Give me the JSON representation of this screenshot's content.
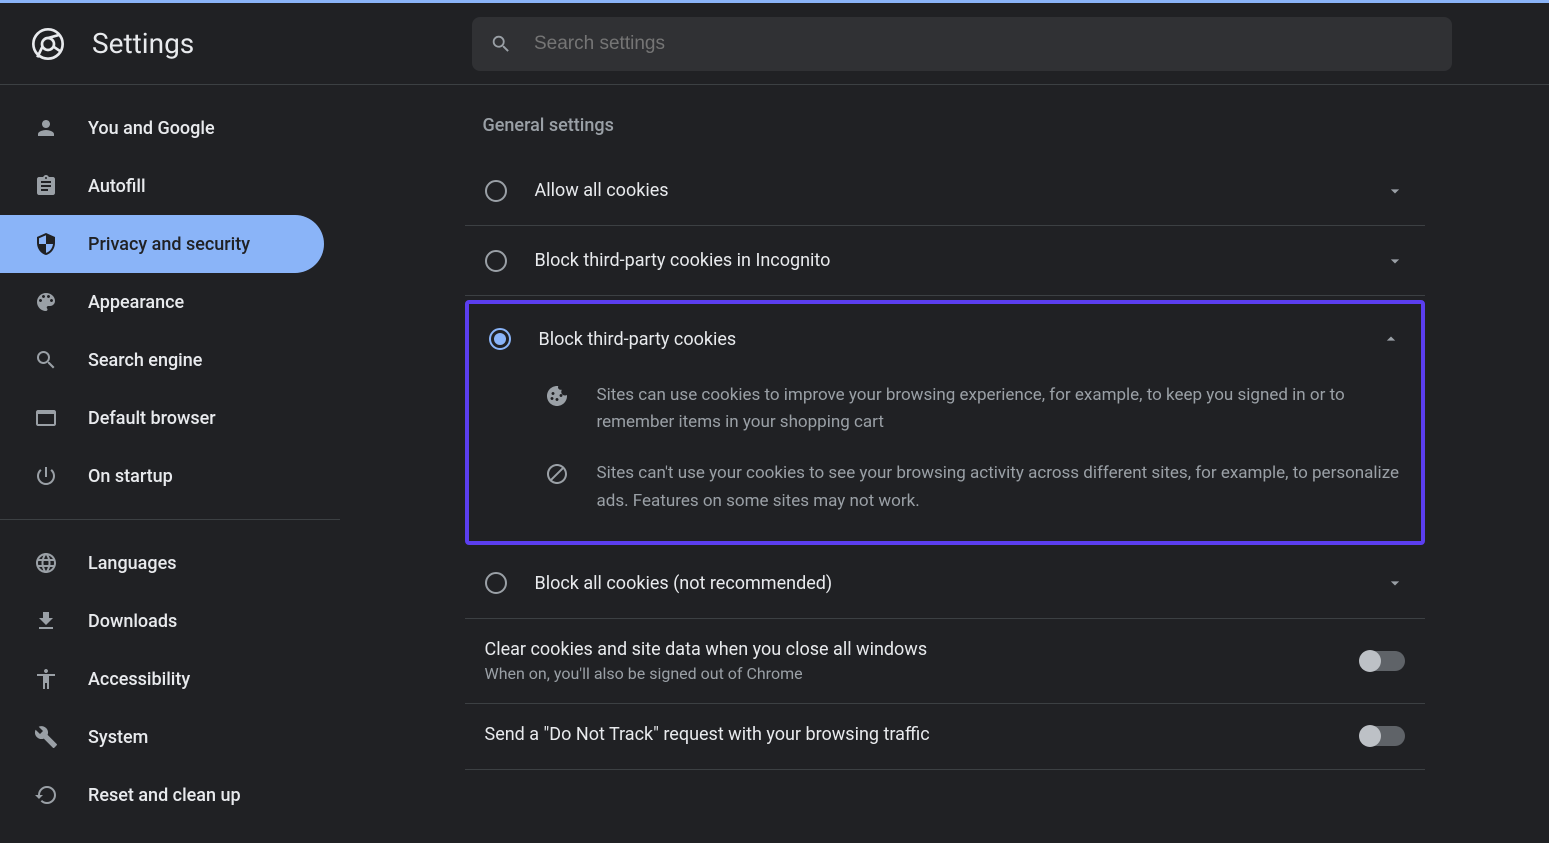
{
  "header": {
    "title": "Settings",
    "search_placeholder": "Search settings"
  },
  "sidebar": {
    "items": [
      {
        "label": "You and Google",
        "icon": "person"
      },
      {
        "label": "Autofill",
        "icon": "clipboard"
      },
      {
        "label": "Privacy and security",
        "icon": "shield",
        "active": true
      },
      {
        "label": "Appearance",
        "icon": "palette"
      },
      {
        "label": "Search engine",
        "icon": "search"
      },
      {
        "label": "Default browser",
        "icon": "browser"
      },
      {
        "label": "On startup",
        "icon": "power"
      }
    ],
    "items2": [
      {
        "label": "Languages",
        "icon": "globe"
      },
      {
        "label": "Downloads",
        "icon": "download"
      },
      {
        "label": "Accessibility",
        "icon": "accessibility"
      },
      {
        "label": "System",
        "icon": "wrench"
      },
      {
        "label": "Reset and clean up",
        "icon": "restore"
      }
    ]
  },
  "main": {
    "section_label": "General settings",
    "options": [
      {
        "label": "Allow all cookies"
      },
      {
        "label": "Block third-party cookies in Incognito"
      },
      {
        "label": "Block third-party cookies",
        "selected": true,
        "expanded": true
      },
      {
        "label": "Block all cookies (not recommended)"
      }
    ],
    "expanded_details": [
      "Sites can use cookies to improve your browsing experience, for example, to keep you signed in or to remember items in your shopping cart",
      "Sites can't use your cookies to see your browsing activity across different sites, for example, to personalize ads. Features on some sites may not work."
    ],
    "toggles": [
      {
        "title": "Clear cookies and site data when you close all windows",
        "sub": "When on, you'll also be signed out of Chrome"
      },
      {
        "title": "Send a \"Do Not Track\" request with your browsing traffic"
      }
    ]
  }
}
